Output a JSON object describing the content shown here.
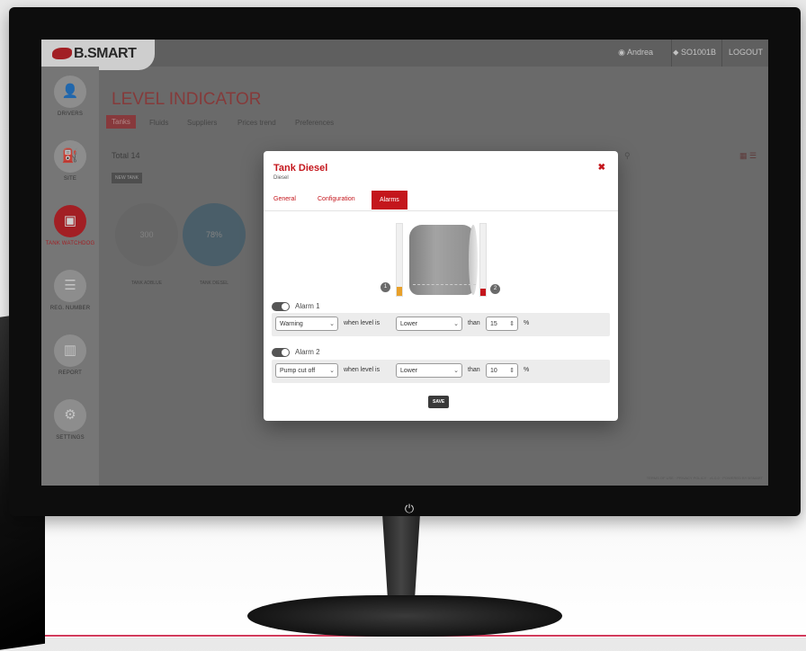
{
  "app": {
    "logo_text": "B.SMART",
    "user_name": "Andrea",
    "site_code": "SO1001B",
    "logout_label": "LOGOUT",
    "page_title": "LEVEL INDICATOR",
    "accent_color": "#c4161c"
  },
  "sidebar": {
    "items": [
      {
        "label": "DRIVERS",
        "icon": "person-icon",
        "glyph": "👤",
        "active": false
      },
      {
        "label": "SITE",
        "icon": "fuel-pump-icon",
        "glyph": "⛽",
        "active": false
      },
      {
        "label": "TANK WATCHDOG",
        "icon": "tank-icon",
        "glyph": "▣",
        "active": true
      },
      {
        "label": "REG. NUMBER",
        "icon": "list-icon",
        "glyph": "☰",
        "active": false
      },
      {
        "label": "REPORT",
        "icon": "chart-icon",
        "glyph": "▥",
        "active": false
      },
      {
        "label": "SETTINGS",
        "icon": "gear-icon",
        "glyph": "⚙",
        "active": false
      }
    ]
  },
  "background": {
    "tabs": [
      "Tanks",
      "Fluids",
      "Suppliers",
      "Prices trend",
      "Preferences"
    ],
    "total_label": "Total",
    "total_value": "14",
    "new_tank_label": "NEW TANK",
    "gauges": [
      {
        "value": "300",
        "label": "TANK ADBLUE"
      },
      {
        "value": "78%",
        "label": "TANK DIESEL"
      }
    ],
    "footer": "TERMS OF USE · PRIVACY POLICY · v1.0.0 · POWERED BY BSMART"
  },
  "modal": {
    "title": "Tank Diesel",
    "subtitle": "Diesel",
    "tabs": [
      "General",
      "Configuration",
      "Alarms"
    ],
    "active_tab": "Alarms",
    "alarm_markers": [
      "1",
      "2"
    ],
    "alarms": [
      {
        "name": "Alarm 1",
        "type": "Warning",
        "condition_text": "when level is",
        "comparison": "Lower",
        "than_text": "than",
        "value": "15",
        "unit": "%"
      },
      {
        "name": "Alarm 2",
        "type": "Pump cut off",
        "condition_text": "when level is",
        "comparison": "Lower",
        "than_text": "than",
        "value": "10",
        "unit": "%"
      }
    ],
    "save_label": "SAVE",
    "left_level_fraction": 0.12,
    "right_level_fraction": 0.1
  }
}
